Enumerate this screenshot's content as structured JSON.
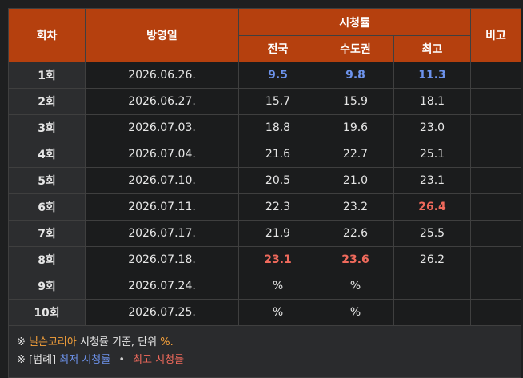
{
  "header": {
    "episode": "회차",
    "air_date": "방영일",
    "ratings_group": "시청률",
    "nationwide": "전국",
    "capital": "수도권",
    "peak": "최고",
    "remarks": "비고"
  },
  "rows": [
    {
      "ep": "1회",
      "date": "2026.06.26.",
      "nationwide": "9.5",
      "capital": "9.8",
      "peak": "11.3",
      "remarks": ""
    },
    {
      "ep": "2회",
      "date": "2026.06.27.",
      "nationwide": "15.7",
      "capital": "15.9",
      "peak": "18.1",
      "remarks": ""
    },
    {
      "ep": "3회",
      "date": "2026.07.03.",
      "nationwide": "18.8",
      "capital": "19.6",
      "peak": "23.0",
      "remarks": ""
    },
    {
      "ep": "4회",
      "date": "2026.07.04.",
      "nationwide": "21.6",
      "capital": "22.7",
      "peak": "25.1",
      "remarks": ""
    },
    {
      "ep": "5회",
      "date": "2026.07.10.",
      "nationwide": "20.5",
      "capital": "21.0",
      "peak": "23.1",
      "remarks": ""
    },
    {
      "ep": "6회",
      "date": "2026.07.11.",
      "nationwide": "22.3",
      "capital": "23.2",
      "peak": "26.4",
      "remarks": ""
    },
    {
      "ep": "7회",
      "date": "2026.07.17.",
      "nationwide": "21.9",
      "capital": "22.6",
      "peak": "25.5",
      "remarks": ""
    },
    {
      "ep": "8회",
      "date": "2026.07.18.",
      "nationwide": "23.1",
      "capital": "23.6",
      "peak": "26.2",
      "remarks": ""
    },
    {
      "ep": "9회",
      "date": "2026.07.24.",
      "nationwide": "%",
      "capital": "%",
      "peak": "",
      "remarks": ""
    },
    {
      "ep": "10회",
      "date": "2026.07.25.",
      "nationwide": "%",
      "capital": "%",
      "peak": "",
      "remarks": ""
    }
  ],
  "notes": {
    "line1_mark": "※",
    "line1_source": "닐슨코리아",
    "line1_text": "시청률 기준, 단위",
    "line1_unit": "%.",
    "line2_mark": "※",
    "line2_label": "[범례]",
    "line2_lowest": "최저 시청률",
    "line2_bullet": "•",
    "line2_highest": "최고 시청률"
  },
  "colors": {
    "header_bg": "#b5400e",
    "lowest": "#6d93ec",
    "highest": "#f06a5c",
    "source": "#f7a23b"
  }
}
